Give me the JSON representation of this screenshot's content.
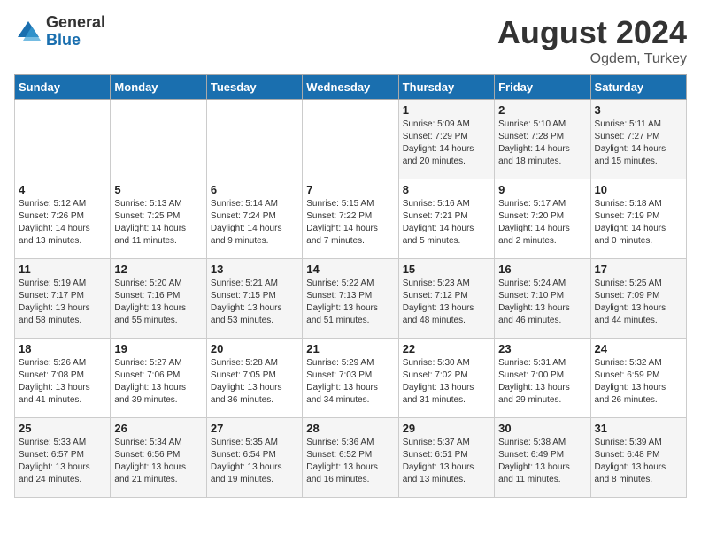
{
  "header": {
    "logo_general": "General",
    "logo_blue": "Blue",
    "month_year": "August 2024",
    "location": "Ogdem, Turkey"
  },
  "days_of_week": [
    "Sunday",
    "Monday",
    "Tuesday",
    "Wednesday",
    "Thursday",
    "Friday",
    "Saturday"
  ],
  "weeks": [
    [
      {
        "day": "",
        "info": ""
      },
      {
        "day": "",
        "info": ""
      },
      {
        "day": "",
        "info": ""
      },
      {
        "day": "",
        "info": ""
      },
      {
        "day": "1",
        "info": "Sunrise: 5:09 AM\nSunset: 7:29 PM\nDaylight: 14 hours\nand 20 minutes."
      },
      {
        "day": "2",
        "info": "Sunrise: 5:10 AM\nSunset: 7:28 PM\nDaylight: 14 hours\nand 18 minutes."
      },
      {
        "day": "3",
        "info": "Sunrise: 5:11 AM\nSunset: 7:27 PM\nDaylight: 14 hours\nand 15 minutes."
      }
    ],
    [
      {
        "day": "4",
        "info": "Sunrise: 5:12 AM\nSunset: 7:26 PM\nDaylight: 14 hours\nand 13 minutes."
      },
      {
        "day": "5",
        "info": "Sunrise: 5:13 AM\nSunset: 7:25 PM\nDaylight: 14 hours\nand 11 minutes."
      },
      {
        "day": "6",
        "info": "Sunrise: 5:14 AM\nSunset: 7:24 PM\nDaylight: 14 hours\nand 9 minutes."
      },
      {
        "day": "7",
        "info": "Sunrise: 5:15 AM\nSunset: 7:22 PM\nDaylight: 14 hours\nand 7 minutes."
      },
      {
        "day": "8",
        "info": "Sunrise: 5:16 AM\nSunset: 7:21 PM\nDaylight: 14 hours\nand 5 minutes."
      },
      {
        "day": "9",
        "info": "Sunrise: 5:17 AM\nSunset: 7:20 PM\nDaylight: 14 hours\nand 2 minutes."
      },
      {
        "day": "10",
        "info": "Sunrise: 5:18 AM\nSunset: 7:19 PM\nDaylight: 14 hours\nand 0 minutes."
      }
    ],
    [
      {
        "day": "11",
        "info": "Sunrise: 5:19 AM\nSunset: 7:17 PM\nDaylight: 13 hours\nand 58 minutes."
      },
      {
        "day": "12",
        "info": "Sunrise: 5:20 AM\nSunset: 7:16 PM\nDaylight: 13 hours\nand 55 minutes."
      },
      {
        "day": "13",
        "info": "Sunrise: 5:21 AM\nSunset: 7:15 PM\nDaylight: 13 hours\nand 53 minutes."
      },
      {
        "day": "14",
        "info": "Sunrise: 5:22 AM\nSunset: 7:13 PM\nDaylight: 13 hours\nand 51 minutes."
      },
      {
        "day": "15",
        "info": "Sunrise: 5:23 AM\nSunset: 7:12 PM\nDaylight: 13 hours\nand 48 minutes."
      },
      {
        "day": "16",
        "info": "Sunrise: 5:24 AM\nSunset: 7:10 PM\nDaylight: 13 hours\nand 46 minutes."
      },
      {
        "day": "17",
        "info": "Sunrise: 5:25 AM\nSunset: 7:09 PM\nDaylight: 13 hours\nand 44 minutes."
      }
    ],
    [
      {
        "day": "18",
        "info": "Sunrise: 5:26 AM\nSunset: 7:08 PM\nDaylight: 13 hours\nand 41 minutes."
      },
      {
        "day": "19",
        "info": "Sunrise: 5:27 AM\nSunset: 7:06 PM\nDaylight: 13 hours\nand 39 minutes."
      },
      {
        "day": "20",
        "info": "Sunrise: 5:28 AM\nSunset: 7:05 PM\nDaylight: 13 hours\nand 36 minutes."
      },
      {
        "day": "21",
        "info": "Sunrise: 5:29 AM\nSunset: 7:03 PM\nDaylight: 13 hours\nand 34 minutes."
      },
      {
        "day": "22",
        "info": "Sunrise: 5:30 AM\nSunset: 7:02 PM\nDaylight: 13 hours\nand 31 minutes."
      },
      {
        "day": "23",
        "info": "Sunrise: 5:31 AM\nSunset: 7:00 PM\nDaylight: 13 hours\nand 29 minutes."
      },
      {
        "day": "24",
        "info": "Sunrise: 5:32 AM\nSunset: 6:59 PM\nDaylight: 13 hours\nand 26 minutes."
      }
    ],
    [
      {
        "day": "25",
        "info": "Sunrise: 5:33 AM\nSunset: 6:57 PM\nDaylight: 13 hours\nand 24 minutes."
      },
      {
        "day": "26",
        "info": "Sunrise: 5:34 AM\nSunset: 6:56 PM\nDaylight: 13 hours\nand 21 minutes."
      },
      {
        "day": "27",
        "info": "Sunrise: 5:35 AM\nSunset: 6:54 PM\nDaylight: 13 hours\nand 19 minutes."
      },
      {
        "day": "28",
        "info": "Sunrise: 5:36 AM\nSunset: 6:52 PM\nDaylight: 13 hours\nand 16 minutes."
      },
      {
        "day": "29",
        "info": "Sunrise: 5:37 AM\nSunset: 6:51 PM\nDaylight: 13 hours\nand 13 minutes."
      },
      {
        "day": "30",
        "info": "Sunrise: 5:38 AM\nSunset: 6:49 PM\nDaylight: 13 hours\nand 11 minutes."
      },
      {
        "day": "31",
        "info": "Sunrise: 5:39 AM\nSunset: 6:48 PM\nDaylight: 13 hours\nand 8 minutes."
      }
    ]
  ]
}
